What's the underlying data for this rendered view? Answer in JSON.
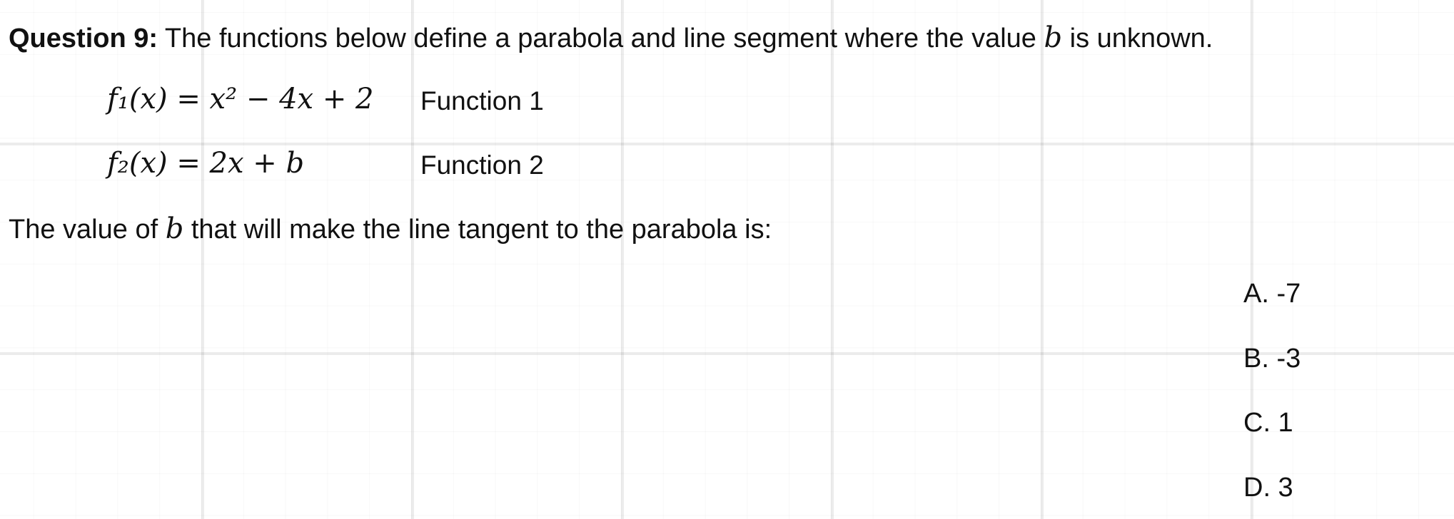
{
  "question": {
    "label": "Question 9:",
    "text_before_variable": " The functions below define a parabola and line segment where the value ",
    "variable": "b",
    "text_after_variable": " is unknown."
  },
  "functions": [
    {
      "formula": "f₁(x) = x² − 4x + 2",
      "label": "Function 1"
    },
    {
      "formula": "f₂(x) = 2x + b",
      "label": "Function 2"
    }
  ],
  "prompt": {
    "text_before_variable": "The value of ",
    "variable": "b",
    "text_after_variable": " that will make the line tangent to the parabola is:"
  },
  "choices": [
    {
      "text": "A. -7"
    },
    {
      "text": "B.  -3"
    },
    {
      "text": "C.  1"
    },
    {
      "text": "D. 3"
    }
  ]
}
